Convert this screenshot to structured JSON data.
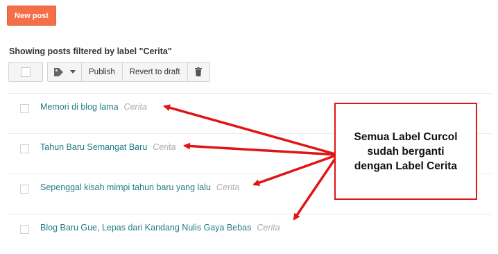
{
  "header": {
    "new_post_label": "New post"
  },
  "filter_heading": "Showing posts filtered by label \"Cerita\"",
  "toolbar": {
    "publish_label": "Publish",
    "revert_label": "Revert to draft"
  },
  "posts": [
    {
      "title": "Memori di blog lama",
      "label": "Cerita"
    },
    {
      "title": "Tahun Baru Semangat Baru",
      "label": "Cerita"
    },
    {
      "title": "Sepenggal kisah mimpi tahun baru yang lalu",
      "label": "Cerita"
    },
    {
      "title": "Blog Baru Gue, Lepas dari Kandang Nulis Gaya Bebas",
      "label": "Cerita"
    }
  ],
  "annotation": {
    "lines": [
      "Semua Label Curcol",
      "sudah berganti",
      "dengan Label Cerita"
    ],
    "color": "#e11414"
  },
  "colors": {
    "accent": "#f26f47",
    "link": "#1f7a86",
    "label": "#aaaaaa"
  }
}
